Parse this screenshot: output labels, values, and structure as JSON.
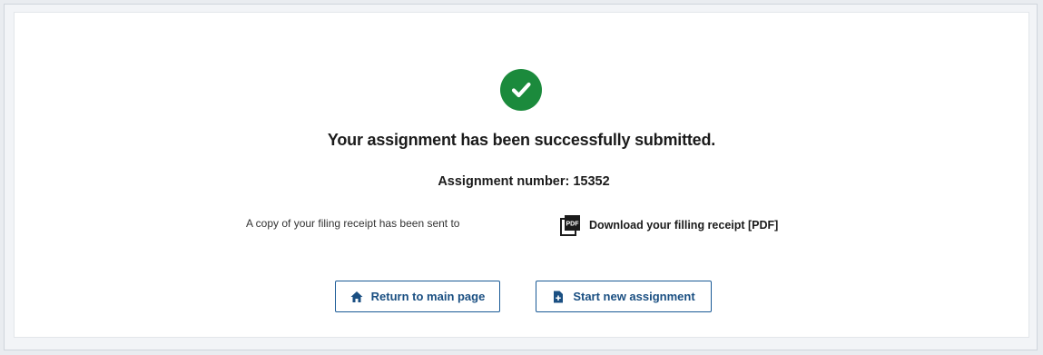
{
  "confirmation": {
    "title": "Your assignment has been successfully submitted.",
    "assignment_label": "Assignment number:",
    "assignment_number": "15352",
    "receipt_text": "A copy of your filing receipt has been sent to",
    "download_label": "Download your filling receipt [PDF]",
    "pdf_icon_text": "PDF"
  },
  "actions": {
    "return_label": "Return to main page",
    "new_label": "Start new assignment"
  },
  "icons": {
    "success": "check-circle-icon",
    "pdf": "pdf-file-icon",
    "home": "home-icon",
    "new": "file-plus-icon"
  },
  "colors": {
    "success": "#1b8a3c",
    "primary": "#1a5a96",
    "text": "#1b1b1b"
  }
}
